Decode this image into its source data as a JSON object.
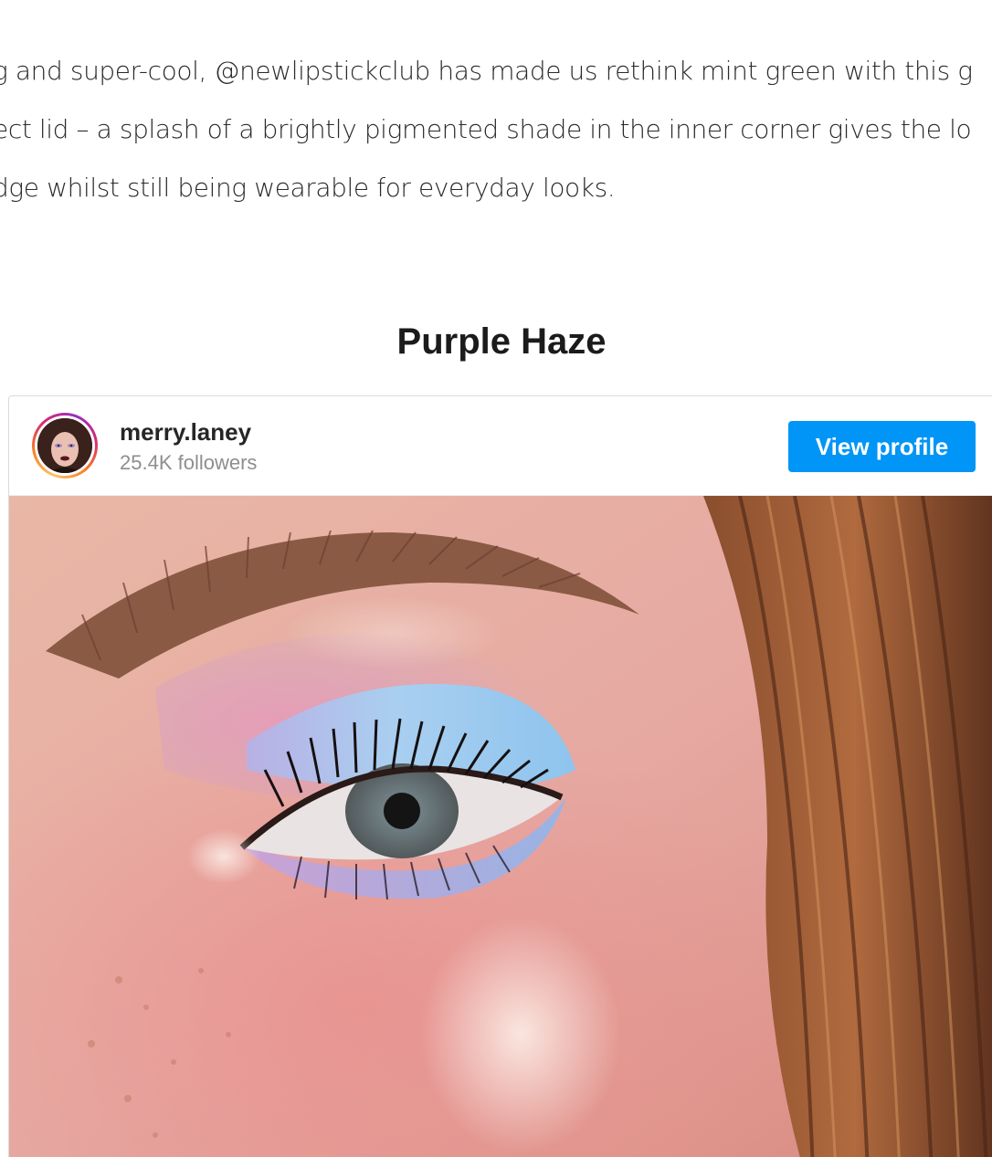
{
  "article": {
    "lines": [
      "g and super-cool, @newlipstickclub has made us rethink mint green with this g",
      "ect lid – a splash of a brightly pigmented shade in the inner corner gives the lo",
      "dge whilst still being wearable for everyday looks."
    ]
  },
  "section": {
    "heading": "Purple Haze"
  },
  "instagram_embed": {
    "username": "merry.laney",
    "followers": "25.4K followers",
    "view_profile_label": "View profile",
    "button_color": "#0095f6",
    "photo_subject": "close-up eye makeup"
  }
}
